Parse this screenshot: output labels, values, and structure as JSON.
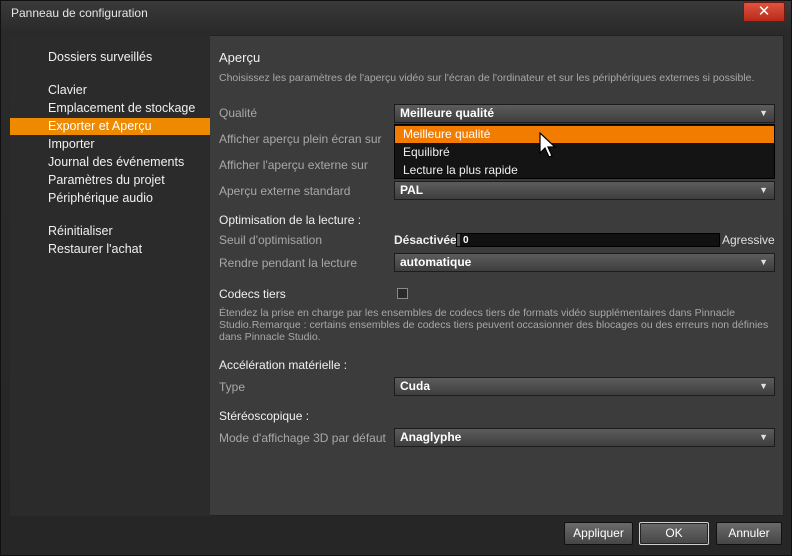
{
  "window": {
    "title": "Panneau de configuration",
    "close_label": "✕"
  },
  "sidebar": {
    "items": [
      {
        "label": "Dossiers surveillés"
      },
      {
        "label": "Clavier"
      },
      {
        "label": "Emplacement de stockage"
      },
      {
        "label": "Exporter et Aperçu"
      },
      {
        "label": "Importer"
      },
      {
        "label": "Journal des événements"
      },
      {
        "label": "Paramètres du projet"
      },
      {
        "label": "Périphérique audio"
      },
      {
        "label": "Réinitialiser"
      },
      {
        "label": "Restaurer l'achat"
      }
    ],
    "active": "Exporter et Aperçu"
  },
  "preview": {
    "heading": "Aperçu",
    "description": "Choisissez les paramètres de l'aperçu vidéo sur l'écran de l'ordinateur et sur les périphériques externes si possible.",
    "quality_label": "Qualité",
    "quality_value": "Meilleure qualité",
    "quality_options": [
      "Meilleure qualité",
      "Equilibré",
      "Lecture la plus rapide"
    ],
    "fullscreen_label": "Afficher aperçu plein écran sur",
    "external_label": "Afficher l'aperçu externe sur",
    "external_standard_label": "Aperçu externe standard",
    "external_standard_value": "PAL"
  },
  "playback": {
    "heading": "Optimisation de la lecture :",
    "threshold_label": "Seuil d'optimisation",
    "threshold_min": "Désactivée",
    "threshold_max": "Agressive",
    "threshold_value": "0",
    "render_label": "Rendre pendant la lecture",
    "render_value": "automatique"
  },
  "codecs": {
    "heading": "Codecs tiers",
    "checked": false,
    "description": "Étendez la prise en charge par les ensembles de codecs tiers de formats vidéo supplémentaires dans Pinnacle Studio.Remarque : certains ensembles de codecs tiers peuvent occasionner des blocages ou des erreurs non définies dans Pinnacle Studio."
  },
  "hardware": {
    "heading": "Accélération matérielle :",
    "type_label": "Type",
    "type_value": "Cuda"
  },
  "stereo": {
    "heading": "Stéréoscopique :",
    "mode_label": "Mode d'affichage 3D par défaut",
    "mode_value": "Anaglyphe"
  },
  "buttons": {
    "apply": "Appliquer",
    "ok": "OK",
    "cancel": "Annuler"
  },
  "icons": {
    "dropdown_arrow": "▼",
    "cursor": "mouse-pointer-icon"
  }
}
